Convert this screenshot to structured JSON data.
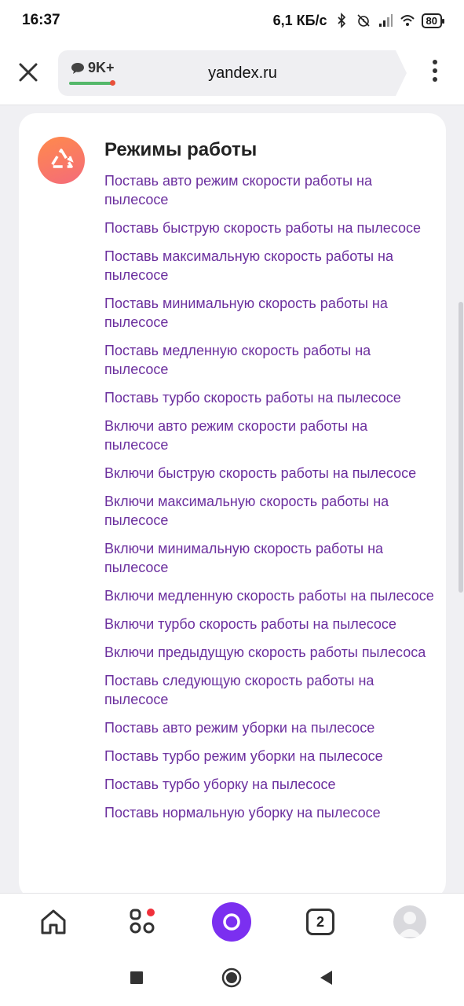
{
  "status_bar": {
    "time": "16:37",
    "speed": "6,1 КБ/с",
    "battery": "80",
    "icons": [
      "bluetooth-icon",
      "alarm-off-icon",
      "signal-icon",
      "wifi-icon",
      "battery-icon"
    ]
  },
  "browser": {
    "tab_badge": "9K+",
    "url": "yandex.ru",
    "icons": [
      "close-icon",
      "comment-icon",
      "more-vertical-icon"
    ]
  },
  "card": {
    "title": "Режимы работы",
    "icon": "mode-cycle-icon",
    "accent_color": "#6b2f9e",
    "commands": [
      "Поставь авто режим скорости работы на пылесосе",
      "Поставь быструю скорость работы на пылесосе",
      "Поставь максимальную скорость работы на пылесосе",
      "Поставь минимальную скорость работы на пылесосе",
      "Поставь медленную скорость работы на пылесосе",
      "Поставь турбо скорость работы на пылесосе",
      "Включи авто режим скорости работы на пылесосе",
      "Включи быструю скорость работы на пылесосе",
      "Включи максимальную скорость работы на пылесосе",
      "Включи минимальную скорость работы на пылесосе",
      "Включи медленную скорость работы на пылесосе",
      "Включи турбо скорость работы на пылесосе",
      "Включи предыдущую скорость работы пылесоса",
      "Поставь следующую скорость работы на пылесосе",
      "Поставь авто режим уборки на пылесосе",
      "Поставь турбо режим уборки на пылесосе",
      "Поставь турбо уборку на пылесосе",
      "Поставь нормальную уборку на пылесосе"
    ]
  },
  "bottom_nav": {
    "tabs_count": "2",
    "icons": [
      "home-icon",
      "services-grid-icon",
      "alice-icon",
      "tabs-icon",
      "profile-avatar-icon"
    ],
    "alice_color": "#7b2ff0"
  },
  "system_nav": {
    "icons": [
      "recents-square-icon",
      "home-circle-icon",
      "back-triangle-icon"
    ]
  }
}
